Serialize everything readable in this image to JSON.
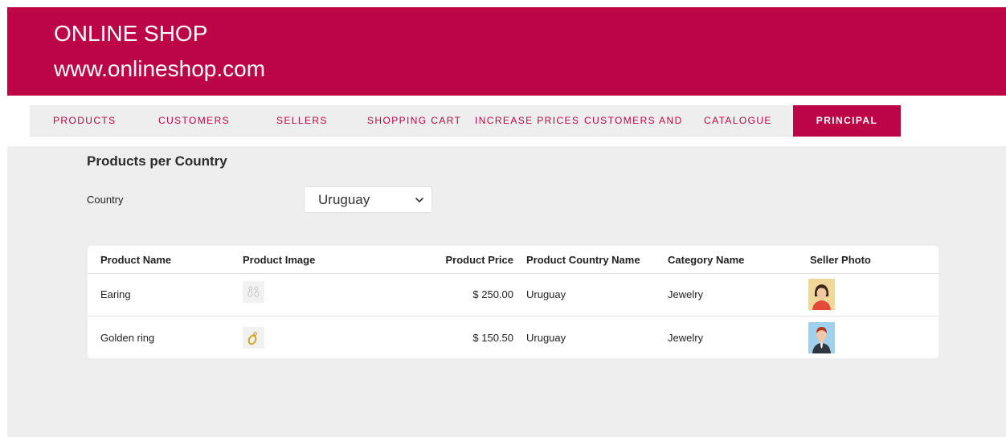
{
  "header": {
    "title": "ONLINE SHOP",
    "subtitle": "www.onlineshop.com"
  },
  "nav": {
    "items": [
      {
        "label": "PRODUCTS"
      },
      {
        "label": "CUSTOMERS"
      },
      {
        "label": "SELLERS"
      },
      {
        "label": "SHOPPING CART"
      },
      {
        "label": "INCREASE PRICES"
      },
      {
        "label": "CUSTOMERS AND"
      },
      {
        "label": "CATALOGUE"
      },
      {
        "label": "PRINCIPAL",
        "active": true
      }
    ]
  },
  "main": {
    "section_title": "Products per Country",
    "country_label": "Country",
    "country_selected": "Uruguay"
  },
  "table": {
    "columns": [
      "Product Name",
      "Product Image",
      "Product Price",
      "Product Country Name",
      "Category Name",
      "Seller Photo"
    ],
    "rows": [
      {
        "name": "Earing",
        "image_icon": "earring-thumbnail",
        "price": "$ 250.00",
        "country": "Uruguay",
        "category": "Jewelry",
        "seller_photo": "female-seller-avatar"
      },
      {
        "name": "Golden ring",
        "image_icon": "ring-thumbnail",
        "price": "$ 150.50",
        "country": "Uruguay",
        "category": "Jewelry",
        "seller_photo": "male-seller-avatar"
      }
    ]
  },
  "colors": {
    "brand": "#bc0547",
    "background": "#eeeeee",
    "card": "#ffffff"
  }
}
